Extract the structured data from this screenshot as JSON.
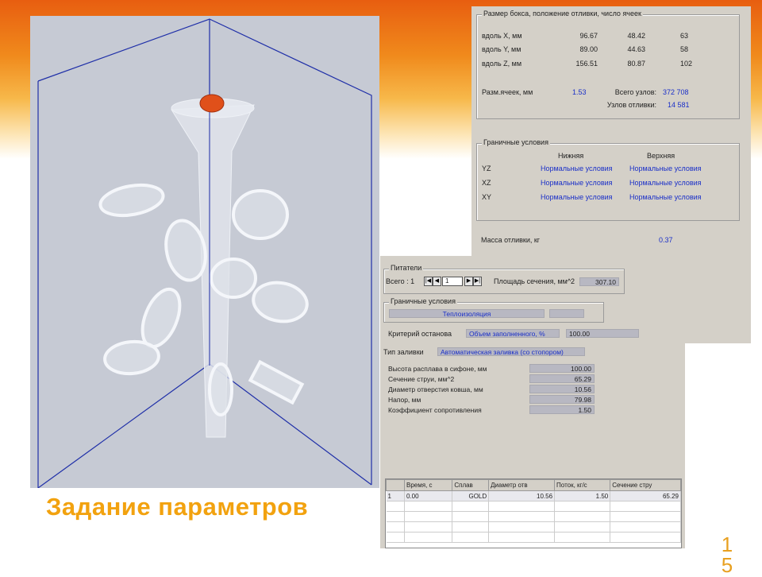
{
  "slide": {
    "title": "Задание параметров",
    "page_number": "15"
  },
  "box": {
    "title": "Размер бокса, положение отливки, число ячеек",
    "rows": [
      {
        "label": "вдоль X, мм",
        "v1": "96.67",
        "v2": "48.42",
        "v3": "63"
      },
      {
        "label": "вдоль Y, мм",
        "v1": "89.00",
        "v2": "44.63",
        "v3": "58"
      },
      {
        "label": "вдоль Z, мм",
        "v1": "156.51",
        "v2": "80.87",
        "v3": "102"
      }
    ],
    "cell_size_label": "Разм.ячеек, мм",
    "cell_size_value": "1.53",
    "total_nodes_label": "Всего узлов:",
    "total_nodes_value": "372 708",
    "casting_nodes_label": "Узлов отливки:",
    "casting_nodes_value": "14 581"
  },
  "boundary": {
    "title": "Граничные условия",
    "col_lower": "Нижняя",
    "col_upper": "Верхняя",
    "rows": [
      {
        "axis": "YZ",
        "lower": "Нормальные условия",
        "upper": "Нормальные условия"
      },
      {
        "axis": "XZ",
        "lower": "Нормальные условия",
        "upper": "Нормальные условия"
      },
      {
        "axis": "XY",
        "lower": "Нормальные условия",
        "upper": "Нормальные условия"
      }
    ]
  },
  "mass": {
    "label": "Масса отливки, кг",
    "value": "0.37"
  },
  "gates": {
    "title": "Питатели",
    "total_label": "Всего : 1",
    "current_index": "1",
    "area_label": "Площадь сечения, мм^2",
    "area_value": "307.10"
  },
  "boundary2": {
    "title": "Граничные условия",
    "value": "Теплоизоляция"
  },
  "stop": {
    "label": "Критерий останова",
    "type": "Объем заполненного, %",
    "value": "100.00"
  },
  "fill": {
    "label": "Тип заливки",
    "value": "Автоматическая заливка (со стопором)"
  },
  "params": [
    {
      "label": "Высота расплава в сифоне, мм",
      "value": "100.00"
    },
    {
      "label": "Сечение струи, мм^2",
      "value": "65.29"
    },
    {
      "label": "Диаметр отверстия ковша, мм",
      "value": "10.56"
    },
    {
      "label": "Напор, мм",
      "value": "79.98"
    },
    {
      "label": "Коэффициент сопротивления",
      "value": "1.50"
    }
  ],
  "table": {
    "headers": [
      "",
      "Время, с",
      "Сплав",
      "Диаметр отв",
      "Поток, кг/с",
      "Сечение стру"
    ],
    "rows": [
      [
        "1",
        "0.00",
        "GOLD",
        "10.56",
        "1.50",
        "65.29"
      ]
    ]
  },
  "colors": {
    "accent": "#f2a20f",
    "link_blue": "#1a2fc8",
    "panel": "#d4d0c8",
    "scene": "#c6cad4",
    "pouring_cup_marker": "#e0501a"
  }
}
